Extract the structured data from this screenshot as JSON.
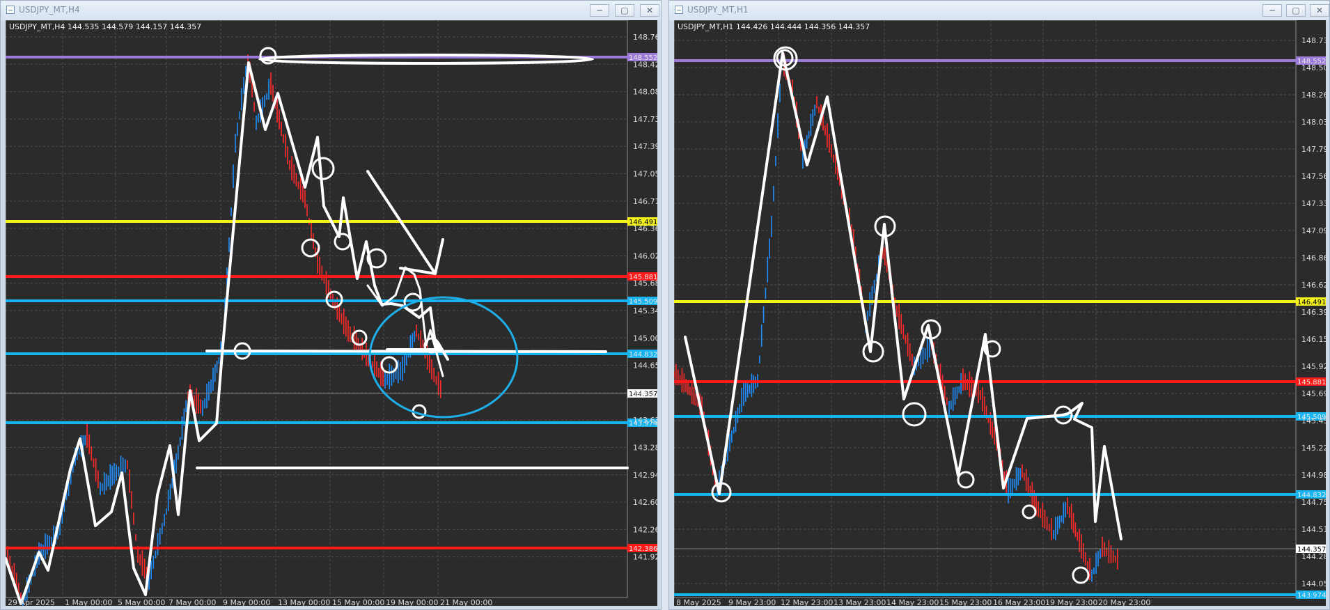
{
  "left_window": {
    "title": "USDJPY_MT,H4",
    "header": "USDJPY_MT,H4  144.535 144.579 144.157 144.357",
    "y_labels": [
      "148.760",
      "148.420",
      "148.080",
      "147.735",
      "147.395",
      "147.050",
      "146.710",
      "146.365",
      "146.025",
      "145.680",
      "145.340",
      "145.000",
      "144.655",
      "144.315",
      "143.630",
      "143.285",
      "142.945",
      "142.605",
      "142.260",
      "141.920"
    ],
    "x_labels": [
      "29 Apr 2025",
      "1 May 00:00",
      "5 May 00:00",
      "7 May 00:00",
      "9 May 00:00",
      "13 May 00:00",
      "15 May 00:00",
      "19 May 00:00",
      "21 May 00:00"
    ],
    "levels": [
      {
        "value": "148.552",
        "color": "#9b7ad8"
      },
      {
        "value": "146.491",
        "color": "#f2f21a"
      },
      {
        "value": "145.881",
        "color": "#ff1a1a"
      },
      {
        "value": "145.509",
        "color": "#16b5f0"
      },
      {
        "value": "144.832",
        "color": "#16b5f0"
      },
      {
        "value": "144.357",
        "color": "#ffffff"
      },
      {
        "value": "143.974",
        "color": "#16b5f0"
      },
      {
        "value": "142.386",
        "color": "#ff1a1a"
      }
    ]
  },
  "right_window": {
    "title": "USDJPY_MT,H1",
    "header": "USDJPY_MT,H1  144.426 144.444 144.356 144.357",
    "y_labels": [
      "148.735",
      "148.500",
      "148.265",
      "148.030",
      "147.795",
      "147.565",
      "147.330",
      "147.095",
      "146.860",
      "146.625",
      "146.390",
      "146.155",
      "145.925",
      "145.690",
      "145.455",
      "145.220",
      "144.985",
      "144.750",
      "144.515",
      "144.285",
      "144.050"
    ],
    "x_labels": [
      "8 May 2025",
      "9 May 23:00",
      "12 May 23:00",
      "13 May 23:00",
      "14 May 23:00",
      "15 May 23:00",
      "16 May 23:00",
      "19 May 23:00",
      "20 May 23:00"
    ],
    "levels": [
      {
        "value": "148.552",
        "color": "#9b7ad8"
      },
      {
        "value": "146.491",
        "color": "#f2f21a"
      },
      {
        "value": "145.881",
        "color": "#ff1a1a"
      },
      {
        "value": "145.509",
        "color": "#16b5f0"
      },
      {
        "value": "144.832",
        "color": "#16b5f0"
      },
      {
        "value": "144.357",
        "color": "#ffffff"
      },
      {
        "value": "143.974",
        "color": "#16b5f0"
      }
    ]
  },
  "window_controls": {
    "minimize": "−",
    "maximize": "▢",
    "close": "✕"
  },
  "colors": {
    "bull": "#1f8fff",
    "bear": "#ff2a2a",
    "drawing": "#ffffff",
    "ellipse": "#1eaee8"
  }
}
